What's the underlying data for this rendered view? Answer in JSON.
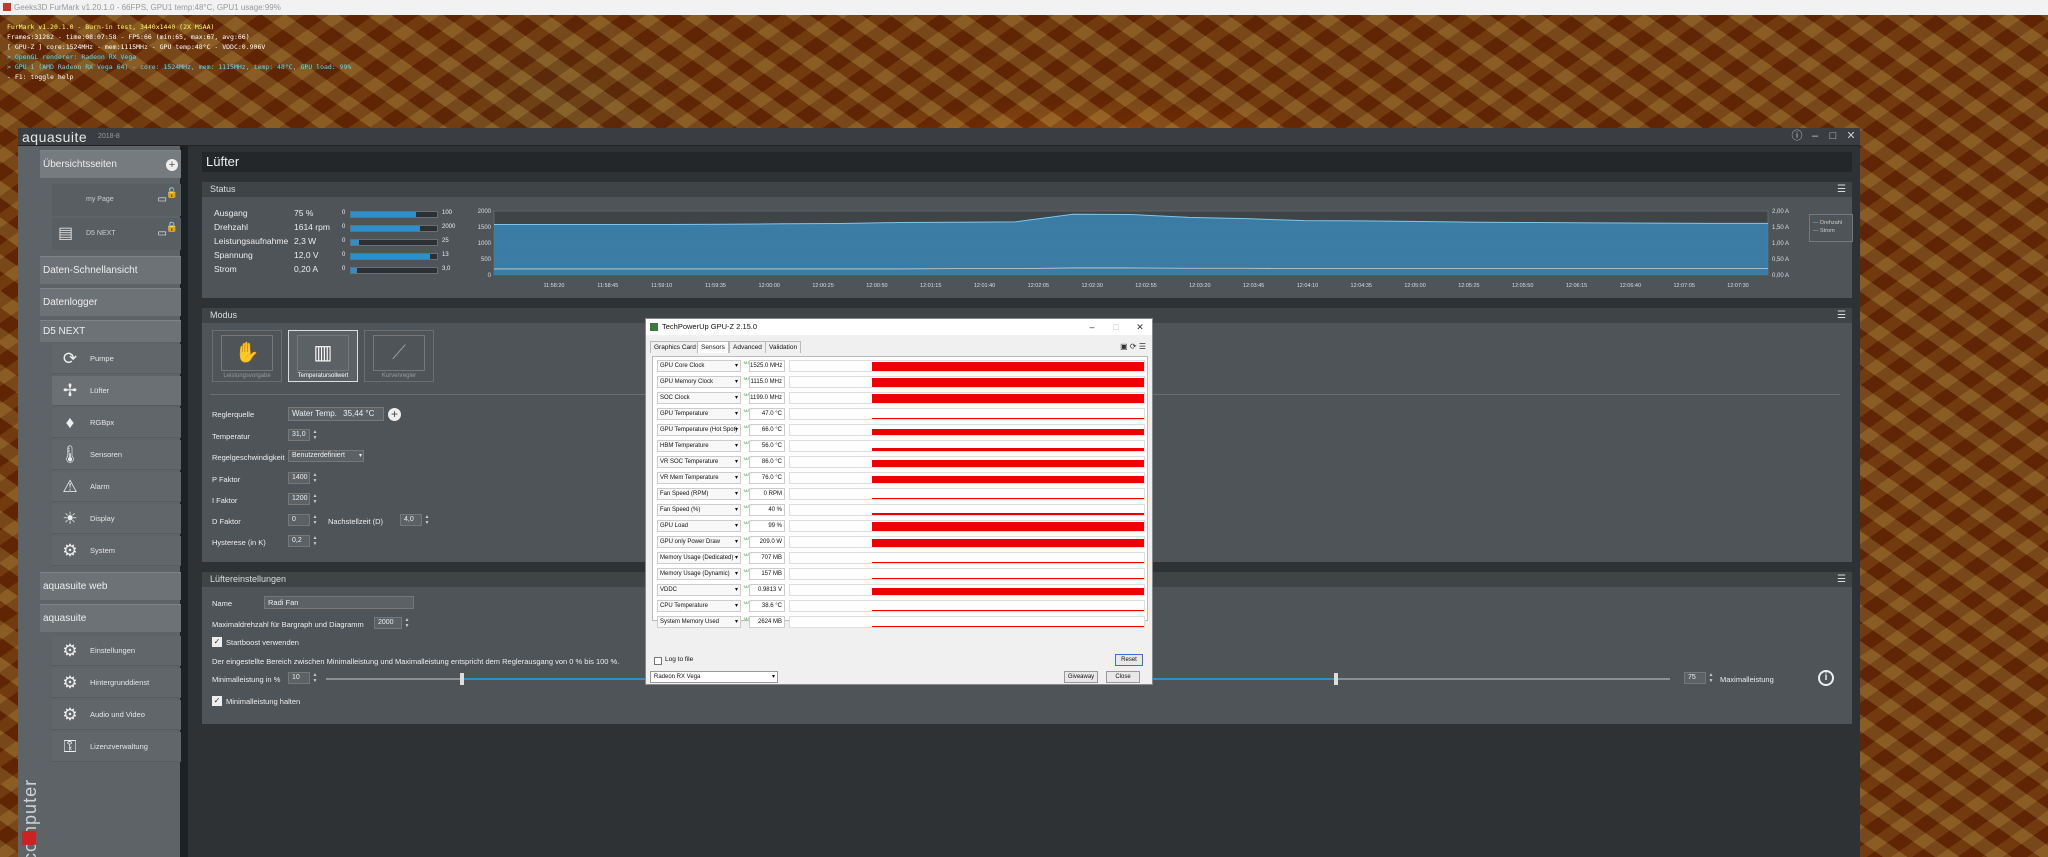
{
  "furmark": {
    "titlebar": "Geeks3D FurMark v1.20.1.0 - 66FPS, GPU1 temp:48°C, GPU1 usage:99%",
    "overlay": [
      "FurMark v1.20.1.0 - Burn-in test, 3440x1440 (2X MSAA)",
      "Frames:31282 - time:08:07:58 - FPS:66 (min:65, max:67, avg:66)",
      "[ GPU-Z ] core:1524MHz - mem:1115MHz - GPU temp:48°C - VDDC:0.906V",
      "> OpenGL renderer: Radeon RX Vega",
      "> GPU 1 (AMD Radeon RX Vega 64) - core: 1524MHz, mem: 1115MHz, temp: 48°C, GPU load: 99%",
      "- F1: toggle help"
    ]
  },
  "aquasuite": {
    "title": "aquasuite",
    "version": "2018-8",
    "brand": "aquacomputer",
    "sidebar": {
      "overview": "Übersichtsseiten",
      "pages": [
        {
          "label": "my Page"
        },
        {
          "label": "D5 NEXT"
        }
      ],
      "sections": [
        "Daten-Schnellansicht",
        "Datenlogger",
        "D5 NEXT"
      ],
      "device_items": [
        {
          "label": "Pumpe",
          "icon": "pump-icon",
          "glyph": "⟳"
        },
        {
          "label": "Lüfter",
          "icon": "fan-icon",
          "glyph": "✢"
        },
        {
          "label": "RGBpx",
          "icon": "led-icon",
          "glyph": "♦"
        },
        {
          "label": "Sensoren",
          "icon": "thermometer-icon",
          "glyph": "🌡"
        },
        {
          "label": "Alarm",
          "icon": "warning-icon",
          "glyph": "⚠"
        },
        {
          "label": "Display",
          "icon": "brightness-icon",
          "glyph": "☀"
        },
        {
          "label": "System",
          "icon": "gear-icon",
          "glyph": "⚙"
        }
      ],
      "web": "aquasuite web",
      "suite": "aquasuite",
      "suite_items": [
        {
          "label": "Einstellungen",
          "icon": "gear-icon",
          "glyph": "⚙"
        },
        {
          "label": "Hintergrunddienst",
          "icon": "gear-icon",
          "glyph": "⚙"
        },
        {
          "label": "Audio und Video",
          "icon": "gear-icon",
          "glyph": "⚙"
        },
        {
          "label": "Lizenzverwaltung",
          "icon": "key-icon",
          "glyph": "⚿"
        }
      ]
    },
    "page_title": "Lüfter",
    "status": {
      "header": "Status",
      "rows": [
        {
          "label": "Ausgang",
          "value": "75 %",
          "min": "0",
          "max": "100",
          "fraction": 0.75
        },
        {
          "label": "Drehzahl",
          "value": "1614 rpm",
          "min": "0",
          "max": "2000",
          "fraction": 0.807
        },
        {
          "label": "Leistungsaufnahme",
          "value": "2,3 W",
          "min": "0",
          "max": "25",
          "fraction": 0.092
        },
        {
          "label": "Spannung",
          "value": "12,0 V",
          "min": "0",
          "max": "13",
          "fraction": 0.923
        },
        {
          "label": "Strom",
          "value": "0,20 A",
          "min": "0",
          "max": "3,0",
          "fraction": 0.067
        }
      ],
      "chart": {
        "y_left": [
          "2000",
          "1500",
          "1000",
          "500",
          "0"
        ],
        "y_right": [
          "2,00 A",
          "1,50 A",
          "1,00 A",
          "0,50 A",
          "0,00 A"
        ],
        "x_ticks": [
          "11:58:20",
          "11:58:45",
          "11:59:10",
          "11:59:35",
          "12:00:00",
          "12:00:25",
          "12:00:50",
          "12:01:15",
          "12:01:40",
          "12:02:05",
          "12:02:30",
          "12:02:55",
          "12:03:20",
          "12:03:45",
          "12:04:10",
          "12:04:35",
          "12:05:00",
          "12:05:25",
          "12:05:50",
          "12:06:15",
          "12:06:40",
          "12:07:05",
          "12:07:30"
        ],
        "legend": [
          "Drehzahl",
          "Strom"
        ],
        "rpm_series": [
          1580,
          1580,
          1580,
          1580,
          1585,
          1600,
          1610,
          1640,
          1650,
          1660,
          1900,
          1890,
          1800,
          1760,
          1700,
          1690,
          1670,
          1650,
          1640,
          1630,
          1620,
          1615,
          1614
        ],
        "current_series": [
          0.19,
          0.19,
          0.19,
          0.19,
          0.19,
          0.19,
          0.19,
          0.19,
          0.2,
          0.2,
          0.22,
          0.22,
          0.21,
          0.21,
          0.2,
          0.2,
          0.2,
          0.2,
          0.2,
          0.2,
          0.2,
          0.2,
          0.2
        ],
        "fill_color": "#3a86b4",
        "line_color": "#7fc6ee"
      }
    },
    "modus": {
      "header": "Modus",
      "cards": [
        {
          "label": "Leistungsvorgabe",
          "active": false,
          "glyph": "✋"
        },
        {
          "label": "Temperatursollwert",
          "active": true,
          "glyph": "▥"
        },
        {
          "label": "Kurvenregler",
          "active": false,
          "glyph": "⟋"
        }
      ],
      "reglerquelle_label": "Reglerquelle",
      "reglerquelle_value": "Water Temp.",
      "reglerquelle_temp": "35,44 °C",
      "temperatur_label": "Temperatur",
      "temperatur_value": "31,0",
      "regelgeschw_label": "Regelgeschwindigkeit",
      "regelgeschw_value": "Benutzerdefiniert",
      "p_label": "P Faktor",
      "p_value": "1400",
      "i_label": "I Faktor",
      "i_value": "1200",
      "d_label": "D Faktor",
      "d_value": "0",
      "nachstell_label": "Nachstellzeit (D)",
      "nachstell_value": "4,0",
      "hyst_label": "Hysterese (in K)",
      "hyst_value": "0,2"
    },
    "luefter": {
      "header": "Lüftereinstellungen",
      "name_label": "Name",
      "name_value": "Radi Fan",
      "maxrpm_label": "Maximaldrehzahl für Bargraph und Diagramm",
      "maxrpm_value": "2000",
      "startboost_label": "Startboost verwenden",
      "info_text": "Der eingestellte Bereich zwischen Minimalleistung und Maximalleistung entspricht dem Reglerausgang von 0 % bis 100 %.",
      "min_label": "Minimalleistung in %",
      "min_value": "10",
      "max_value": "75",
      "max_label": "Maximalleistung",
      "min_fraction": 0.1,
      "max_fraction": 0.75,
      "hold_label": "Minimalleistung halten"
    }
  },
  "gpuz": {
    "title": "TechPowerUp GPU-Z 2.15.0",
    "tabs": [
      "Graphics Card",
      "Sensors",
      "Advanced",
      "Validation"
    ],
    "selected_tab": "Sensors",
    "max_tag": "MAX",
    "sensors": [
      {
        "name": "GPU Core Clock",
        "value": "1525.0 MHz",
        "level": 0.95
      },
      {
        "name": "GPU Memory Clock",
        "value": "1115.0 MHz",
        "level": 0.95
      },
      {
        "name": "SOC Clock",
        "value": "1199.0 MHz",
        "level": 0.95
      },
      {
        "name": "GPU Temperature",
        "value": "47.0 °C",
        "level": 0.15
      },
      {
        "name": "GPU Temperature (Hot Spot)",
        "value": "66.0 °C",
        "level": 0.65
      },
      {
        "name": "HBM Temperature",
        "value": "56.0 °C",
        "level": 0.3
      },
      {
        "name": "VR SOC Temperature",
        "value": "86.0 °C",
        "level": 0.75
      },
      {
        "name": "VR Mem Temperature",
        "value": "76.0 °C",
        "level": 0.7
      },
      {
        "name": "Fan Speed (RPM)",
        "value": "0 RPM",
        "level": 0.0
      },
      {
        "name": "Fan Speed (%)",
        "value": "40 %",
        "level": 0.2
      },
      {
        "name": "GPU Load",
        "value": "99 %",
        "level": 0.95
      },
      {
        "name": "GPU only Power Draw",
        "value": "209.0 W",
        "level": 0.8
      },
      {
        "name": "Memory Usage (Dedicated)",
        "value": "707 MB",
        "level": 0.05
      },
      {
        "name": "Memory Usage (Dynamic)",
        "value": "157 MB",
        "level": 0.03
      },
      {
        "name": "VDDC",
        "value": "0.9813 V",
        "level": 0.7
      },
      {
        "name": "CPU Temperature",
        "value": "38.6 °C",
        "level": 0.05
      },
      {
        "name": "System Memory Used",
        "value": "2624 MB",
        "level": 0.08
      }
    ],
    "log_label": "Log to file",
    "reset_label": "Reset",
    "device": "Radeon RX Vega",
    "giveaway_label": "Giveaway",
    "close_label": "Close"
  }
}
